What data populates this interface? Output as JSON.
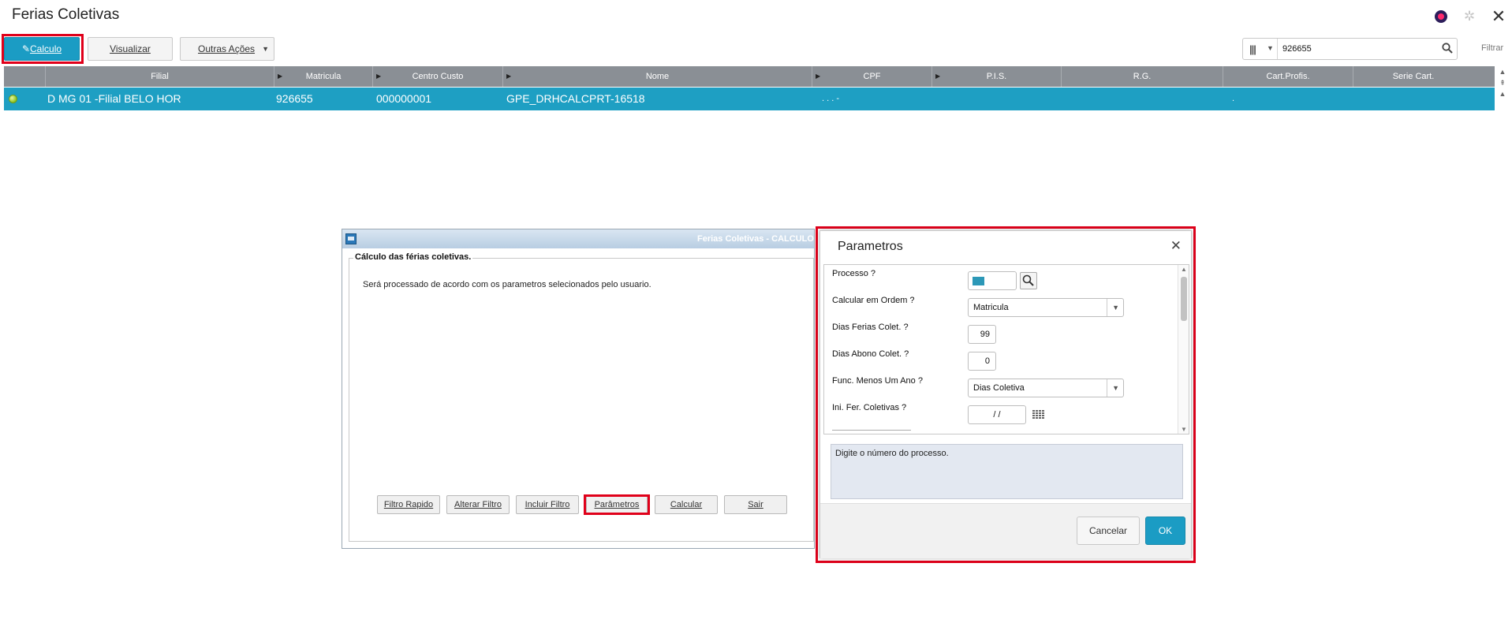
{
  "app": {
    "title": "Ferias Coletivas"
  },
  "toolbar": {
    "calculo_label": "Calculo",
    "visualizar_label": "Visualizar",
    "outras_label": "Outras Ações",
    "search_value": "926655",
    "filtrar_label": "Filtrar"
  },
  "grid": {
    "columns": [
      "Filial",
      "Matricula",
      "Centro Custo",
      "Nome",
      "CPF",
      "P.I.S.",
      "R.G.",
      "Cart.Profis.",
      "Serie Cart."
    ],
    "row": {
      "filial": "D MG 01 -Filial BELO HOR",
      "matricula": "926655",
      "centro_custo": "000000001",
      "nome": "GPE_DRHCALCPRT-16518",
      "cpf": ". . . -",
      "cart_profis": "."
    }
  },
  "process_dialog": {
    "title": "Ferias Coletivas - CALCULO",
    "group_title": "Cálculo das férias coletivas.",
    "description": "Será processado de acordo com os parametros selecionados pelo usuario.",
    "buttons": {
      "filtro_rapido": "Filtro Rapido",
      "alterar_filtro": "Alterar Filtro",
      "incluir_filtro": "Incluir Filtro",
      "parametros": "Parâmetros",
      "calcular": "Calcular",
      "sair": "Sair"
    }
  },
  "param_dialog": {
    "title": "Parametros",
    "fields": {
      "processo_label": "Processo ?",
      "ordem_label": "Calcular em Ordem ?",
      "ordem_value": "Matricula",
      "dias_ferias_label": "Dias Ferias Colet. ?",
      "dias_ferias_value": "99",
      "dias_abono_label": "Dias Abono Colet. ?",
      "dias_abono_value": "0",
      "func_menos_label": "Func. Menos Um Ano ?",
      "func_menos_value": "Dias Coletiva",
      "ini_fer_label": "Ini. Fer. Coletivas ?",
      "ini_fer_value": "/ /"
    },
    "help_text": "Digite o número do processo.",
    "cancel_label": "Cancelar",
    "ok_label": "OK"
  },
  "colors": {
    "accent": "#1b9cc4",
    "highlight": "#e0001a",
    "grid_header": "#8a8f95"
  }
}
